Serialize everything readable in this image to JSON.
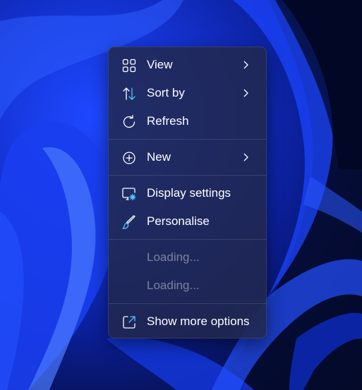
{
  "context_menu": {
    "items": [
      {
        "label": "View",
        "icon": "grid-icon",
        "submenu": true,
        "enabled": true
      },
      {
        "label": "Sort by",
        "icon": "sort-arrows-icon",
        "submenu": true,
        "enabled": true
      },
      {
        "label": "Refresh",
        "icon": "refresh-icon",
        "submenu": false,
        "enabled": true
      },
      {
        "label": "New",
        "icon": "plus-circle-icon",
        "submenu": true,
        "enabled": true
      },
      {
        "label": "Display settings",
        "icon": "display-settings-icon",
        "submenu": false,
        "enabled": true
      },
      {
        "label": "Personalise",
        "icon": "brush-icon",
        "submenu": false,
        "enabled": true
      },
      {
        "label": "Loading...",
        "icon": "",
        "submenu": false,
        "enabled": false
      },
      {
        "label": "Loading...",
        "icon": "",
        "submenu": false,
        "enabled": false
      },
      {
        "label": "Show more options",
        "icon": "open-external-icon",
        "submenu": false,
        "enabled": true
      }
    ]
  },
  "colors": {
    "accent": "#4cc2ff",
    "menu_text": "#ffffff",
    "disabled_text": "#7c829c"
  }
}
